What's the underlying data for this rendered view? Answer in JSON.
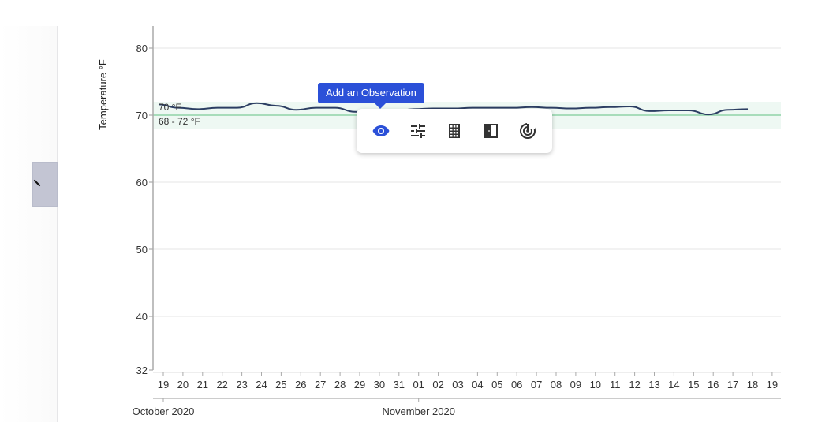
{
  "sidebar": {
    "collapse_icon": "chevron-left-icon"
  },
  "toolbar_popup": {
    "tooltip": "Add an Observation",
    "actions": [
      {
        "icon": "eye-icon",
        "name": "add-observation",
        "active": true
      },
      {
        "icon": "tune-sliders-icon",
        "name": "adjust-settings",
        "active": false
      },
      {
        "icon": "building-icon",
        "name": "building",
        "active": false
      },
      {
        "icon": "door-icon",
        "name": "door",
        "active": false
      },
      {
        "icon": "radar-sensor-icon",
        "name": "sensor",
        "active": false
      }
    ]
  },
  "colors": {
    "line": "#2c3e63",
    "target_line": "#8fd3a8",
    "target_band": "#eef8f3",
    "accent": "#2b50d8",
    "grid": "#e6e6e6"
  },
  "chart_data": {
    "type": "line",
    "title": "",
    "ylabel": "Temperature °F",
    "xlabel": "",
    "ylim": [
      32,
      82
    ],
    "yticks": [
      32,
      40,
      50,
      60,
      70,
      80
    ],
    "grid": true,
    "x_tick_labels": [
      "19",
      "20",
      "21",
      "22",
      "23",
      "24",
      "25",
      "26",
      "27",
      "28",
      "29",
      "30",
      "31",
      "01",
      "02",
      "03",
      "04",
      "05",
      "06",
      "07",
      "08",
      "09",
      "10",
      "11",
      "12",
      "13",
      "14",
      "15",
      "16",
      "17",
      "18",
      "19"
    ],
    "month_labels": [
      {
        "label": "October 2020",
        "day_index": 0
      },
      {
        "label": "November 2020",
        "day_index": 13
      }
    ],
    "target": {
      "value": 70,
      "label": "70 °F"
    },
    "target_band": {
      "low": 68,
      "high": 72,
      "label": "68 - 72 °F"
    },
    "series": [
      {
        "name": "Temperature",
        "x_day_index": [
          0,
          1,
          2,
          3,
          4,
          5,
          6,
          7,
          8,
          9,
          10,
          11,
          12,
          13,
          14,
          15,
          16,
          17,
          18,
          19,
          20,
          21,
          22,
          23,
          24,
          25,
          26,
          27,
          28,
          29,
          30
        ],
        "values": [
          71.6,
          71.1,
          70.9,
          71.1,
          71.1,
          71.8,
          71.4,
          70.8,
          71.1,
          71.1,
          70.5,
          70.4,
          70.6,
          70.9,
          71.0,
          71.0,
          71.1,
          71.1,
          71.1,
          71.2,
          71.1,
          71.0,
          71.1,
          71.2,
          71.3,
          70.6,
          70.7,
          70.7,
          70.1,
          70.8,
          70.9
        ]
      }
    ]
  }
}
